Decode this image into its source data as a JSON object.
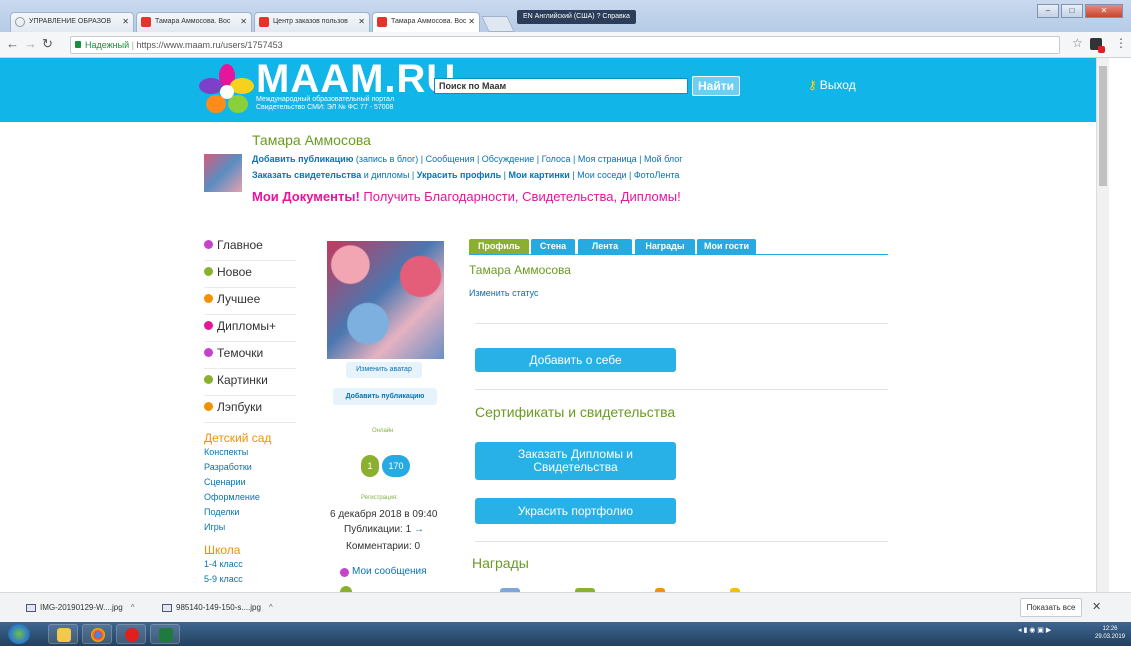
{
  "browser": {
    "tabs": [
      {
        "label": "УПРАВЛЕНИЕ ОБРАЗОВ",
        "favicon": "circle-icon"
      },
      {
        "label": "Тамара Аммосова. Вос",
        "favicon": "maam-icon"
      },
      {
        "label": "Центр заказов пользов",
        "favicon": "maam-icon"
      },
      {
        "label": "Тамара Аммосова. Вос",
        "favicon": "maam-icon"
      }
    ],
    "lang_indicator": "EN Английский (США)   ? Справка",
    "secure_label": "Надежный",
    "url": "https://www.maam.ru/users/1757453"
  },
  "header": {
    "logo_text": "MAAM.RU",
    "logo_sub1": "Международный образовательный портал",
    "logo_sub2": "Свидетельство СМИ: ЭЛ № ФС 77 - 57008",
    "search_placeholder": "Поиск по Маам",
    "search_button": "Найти",
    "logout": "Выход"
  },
  "user": {
    "name": "Тамара Аммосова",
    "links1_bold": "Добавить публикацию",
    "links1_rest": " (запись в блог) | Сообщения | Обсуждение | Голоса | Моя страница | Мой блог",
    "links2_bold1": "Заказать свидетельства",
    "links2_mid1": " и дипломы | ",
    "links2_bold2": "Украсить профиль",
    "links2_mid2": " | ",
    "links2_bold3": "Мои картинки",
    "links2_rest": " | Мои соседи | ФотоЛента",
    "promo_bold": "Мои Документы!",
    "promo_rest": " Получить Благодарности, Свидетельства, Дипломы!"
  },
  "sidebar": {
    "items": [
      {
        "label": "Главное",
        "color": "#c443c9"
      },
      {
        "label": "Новое",
        "color": "#8bb030"
      },
      {
        "label": "Лучшее",
        "color": "#f29200"
      },
      {
        "label": "Дипломы+",
        "color": "#e5159c"
      },
      {
        "label": "Темочки",
        "color": "#c443c9"
      },
      {
        "label": "Картинки",
        "color": "#8bb030"
      },
      {
        "label": "Лэпбуки",
        "color": "#f29200"
      }
    ],
    "cat1": "Детский сад",
    "cat1_links": [
      "Конспекты",
      "Разработки",
      "Сценарии",
      "Оформление",
      "Поделки",
      "Игры"
    ],
    "cat2": "Школа",
    "cat2_links": [
      "1-4 класс",
      "5-9 класс"
    ]
  },
  "profile": {
    "change_avatar": "Изменить аватар",
    "add_pub": "Добавить публикацию",
    "online": "Онлайн",
    "count1": "1",
    "count2": "170",
    "reg_label": "Регистрация:",
    "reg_date": "6 декабря 2018 в 09:40",
    "pubs": "Публикации: 1",
    "pubs_arrow": "→",
    "comments": "Комментарии: 0",
    "my_messages": "Мои сообщения"
  },
  "main": {
    "tabs": [
      "Профиль",
      "Стена",
      "Лента",
      "Награды",
      "Мои гости"
    ],
    "name": "Тамара Аммосова",
    "change_status": "Изменить статус",
    "btn_about": "Добавить о себе",
    "cert_heading": "Сертификаты и свидетельства",
    "btn_order_line1": "Заказать Дипломы и",
    "btn_order_line2": "Свидетельства",
    "btn_portfolio": "Украсить портфолио",
    "awards_heading": "Награды"
  },
  "downloads": {
    "items": [
      "IMG-20190129-W....jpg",
      "985140-149-150-s....jpg"
    ],
    "show_all": "Показать все"
  },
  "taskbar": {
    "time": "12:26",
    "date": "29.03.2019"
  }
}
